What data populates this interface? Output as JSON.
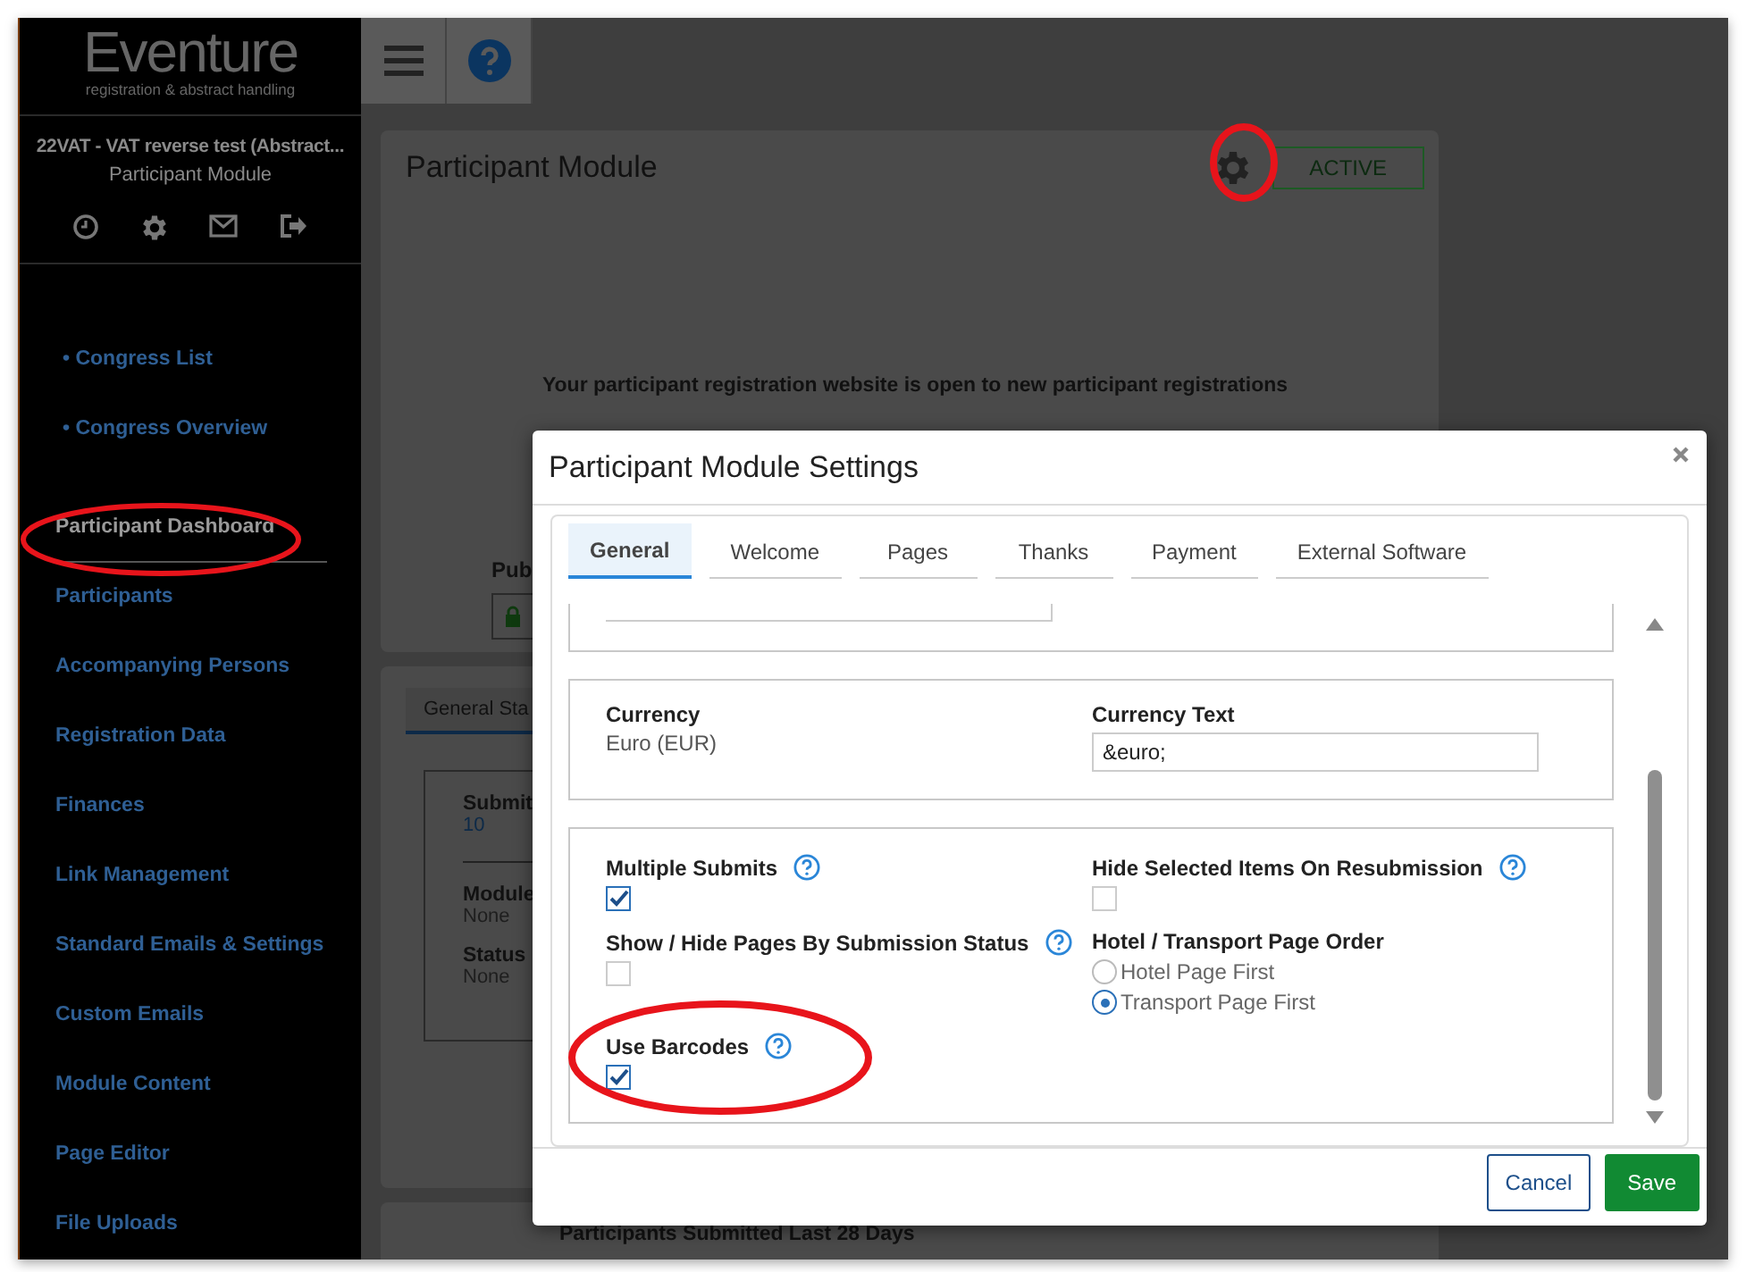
{
  "logo": {
    "name": "Eventure",
    "tagline": "registration & abstract handling"
  },
  "event": {
    "title": "22VAT - VAT reverse test (Abstract...",
    "module": "Participant Module"
  },
  "nav": [
    {
      "label": "• Congress List",
      "kind": "crumb",
      "selected": false
    },
    {
      "label": "• Congress Overview",
      "kind": "crumb",
      "selected": false
    },
    {
      "label": "Participant Dashboard",
      "kind": "link",
      "selected": true
    },
    {
      "label": "Participants",
      "kind": "link",
      "selected": false
    },
    {
      "label": "Accompanying Persons",
      "kind": "link",
      "selected": false
    },
    {
      "label": "Registration Data",
      "kind": "link",
      "selected": false
    },
    {
      "label": "Finances",
      "kind": "link",
      "selected": false
    },
    {
      "label": "Link Management",
      "kind": "link",
      "selected": false
    },
    {
      "label": "Standard Emails & Settings",
      "kind": "link",
      "selected": false
    },
    {
      "label": "Custom Emails",
      "kind": "link",
      "selected": false
    },
    {
      "label": "Module Content",
      "kind": "link",
      "selected": false
    },
    {
      "label": "Page Editor",
      "kind": "link",
      "selected": false
    },
    {
      "label": "File Uploads",
      "kind": "link",
      "selected": false
    }
  ],
  "module_card": {
    "title": "Participant Module",
    "status": "ACTIVE",
    "message": "Your participant registration website is open to new participant registrations",
    "public_label": "Pub"
  },
  "stats_card": {
    "tab": "General Sta",
    "items": [
      {
        "label": "Submit",
        "value": "10",
        "kind": "link"
      },
      {
        "label": "Module",
        "value": "None",
        "kind": "plain"
      },
      {
        "label": "Status",
        "value": "None",
        "kind": "plain"
      }
    ]
  },
  "chart_card": {
    "title": "Participants Submitted Last 28 Days"
  },
  "modal": {
    "title": "Participant Module Settings",
    "tabs": [
      {
        "label": "General",
        "selected": true
      },
      {
        "label": "Welcome",
        "selected": false
      },
      {
        "label": "Pages",
        "selected": false
      },
      {
        "label": "Thanks",
        "selected": false
      },
      {
        "label": "Payment",
        "selected": false
      },
      {
        "label": "External Software",
        "selected": false
      }
    ],
    "currency": {
      "label": "Currency",
      "value": "Euro (EUR)"
    },
    "currency_text": {
      "label": "Currency Text",
      "value": "&euro;"
    },
    "options": [
      {
        "kind": "checkbox",
        "label": "Multiple Submits",
        "help": true,
        "checked": true
      },
      {
        "kind": "checkbox",
        "label": "Hide Selected Items On Resubmission",
        "help": true,
        "checked": false
      },
      {
        "kind": "checkbox",
        "label": "Show / Hide Pages By Submission Status",
        "help": true,
        "checked": false
      },
      {
        "kind": "radio",
        "label": "Hotel / Transport Page Order",
        "choices": [
          {
            "label": "Hotel Page First",
            "selected": false
          },
          {
            "label": "Transport Page First",
            "selected": true
          }
        ]
      },
      {
        "kind": "checkbox",
        "label": "Use Barcodes",
        "help": true,
        "checked": true
      }
    ],
    "buttons": [
      {
        "label": "Cancel",
        "kind": "secondary"
      },
      {
        "label": "Save",
        "kind": "primary"
      }
    ]
  }
}
